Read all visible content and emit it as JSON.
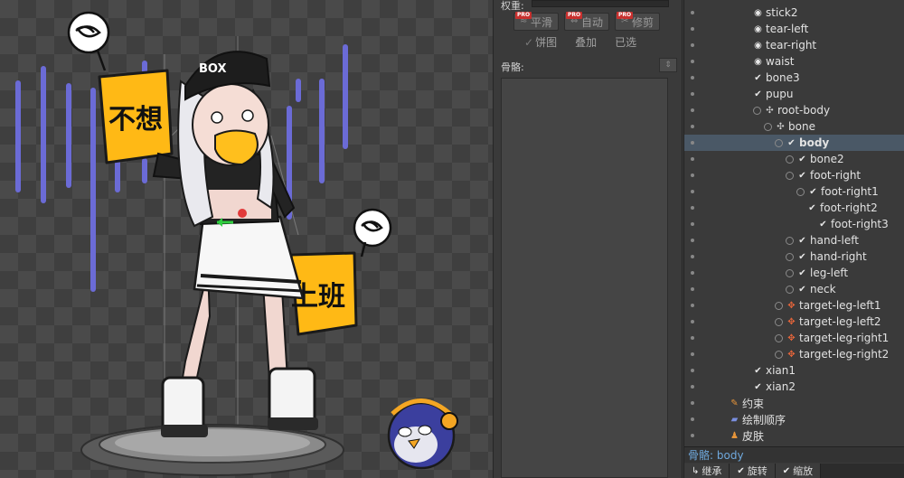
{
  "viewport": {
    "sign_left_text": "不想",
    "sign_right_text": "上班",
    "cap_logo_text": "BOX",
    "colors": {
      "bars": "#6b6bd6",
      "sign": "#ffb915",
      "sign_edge": "#c98a00",
      "penguin": "#3b3f9e",
      "headphones": "#f4a623"
    }
  },
  "mid_panel": {
    "weight_label": "权重:",
    "tools": [
      {
        "label": "平滑",
        "icon": "smooth-icon",
        "pro": "PRO"
      },
      {
        "label": "自动",
        "icon": "auto-icon",
        "pro": "PRO"
      },
      {
        "label": "修剪",
        "icon": "prune-icon",
        "pro": "PRO"
      }
    ],
    "options": [
      {
        "label": "饼图",
        "checked": true
      },
      {
        "label": "叠加",
        "checked": false
      },
      {
        "label": "已选",
        "checked": false
      }
    ],
    "bones_label": "骨骼:",
    "bones_btn": "⇕"
  },
  "tree": {
    "items": [
      {
        "label": "stick2",
        "depth": 0,
        "icon": "radio-bone-icon"
      },
      {
        "label": "tear-left",
        "depth": 0,
        "icon": "radio-bone-icon"
      },
      {
        "label": "tear-right",
        "depth": 0,
        "icon": "radio-bone-icon"
      },
      {
        "label": "waist",
        "depth": 0,
        "icon": "radio-bone-icon"
      },
      {
        "label": "bone3",
        "depth": 0,
        "icon": "bone-icon"
      },
      {
        "label": "pupu",
        "depth": 0,
        "icon": "bone-icon"
      },
      {
        "label": "root-body",
        "depth": 0,
        "icon": "root-icon"
      },
      {
        "label": "bone",
        "depth": 1,
        "icon": "root-icon"
      },
      {
        "label": "body",
        "depth": 2,
        "icon": "bone-icon",
        "selected": true
      },
      {
        "label": "bone2",
        "depth": 3,
        "icon": "bone-icon"
      },
      {
        "label": "foot-right",
        "depth": 3,
        "icon": "bone-icon"
      },
      {
        "label": "foot-right1",
        "depth": 4,
        "icon": "bone-icon"
      },
      {
        "label": "foot-right2",
        "depth": 5,
        "icon": "bone-icon"
      },
      {
        "label": "foot-right3",
        "depth": 6,
        "icon": "bone-icon"
      },
      {
        "label": "hand-left",
        "depth": 3,
        "icon": "bone-icon"
      },
      {
        "label": "hand-right",
        "depth": 3,
        "icon": "bone-icon"
      },
      {
        "label": "leg-left",
        "depth": 3,
        "icon": "bone-icon"
      },
      {
        "label": "neck",
        "depth": 3,
        "icon": "bone-icon"
      },
      {
        "label": "target-leg-left1",
        "depth": 2,
        "icon": "ik-target-icon"
      },
      {
        "label": "target-leg-left2",
        "depth": 2,
        "icon": "ik-target-icon"
      },
      {
        "label": "target-leg-right1",
        "depth": 2,
        "icon": "ik-target-icon"
      },
      {
        "label": "target-leg-right2",
        "depth": 2,
        "icon": "ik-target-icon"
      },
      {
        "label": "xian1",
        "depth": 0,
        "icon": "bone-icon"
      },
      {
        "label": "xian2",
        "depth": 0,
        "icon": "bone-icon"
      },
      {
        "label": "约束",
        "depth": -1,
        "icon": "constraint-icon"
      },
      {
        "label": "绘制顺序",
        "depth": -1,
        "icon": "draw-order-icon"
      },
      {
        "label": "皮肤",
        "depth": -1,
        "icon": "skin-icon"
      }
    ],
    "status_prefix": "骨骼:",
    "status_value": "body",
    "bottom_tabs": [
      {
        "label": "继承"
      },
      {
        "label": "旋转"
      },
      {
        "label": "缩放"
      }
    ]
  }
}
